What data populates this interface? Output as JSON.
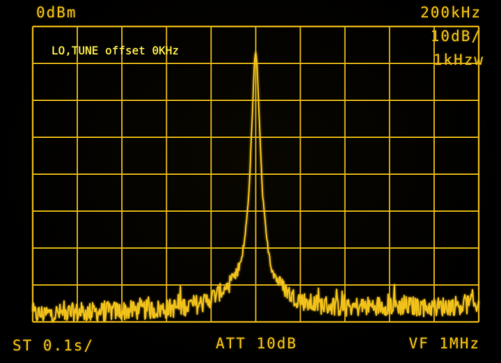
{
  "colors": {
    "phosphor": "#e8b914",
    "trace": "#f2c21b",
    "annotation": "#fff04a",
    "background": "#000000"
  },
  "readouts": {
    "ref_level": "0dBm",
    "span": "200kHz",
    "scale": "10dB/",
    "rbw": "1kHzw",
    "sweep_time": "ST 0.1s/",
    "attenuation": "ATT 10dB",
    "video_filter": "VF 1MHz"
  },
  "annotation": {
    "text": "LO,TUNE offset 0KHz"
  },
  "chart_data": {
    "type": "line",
    "grid": true,
    "grid_divisions": {
      "x": 10,
      "y": 8
    },
    "x_range_divisions": [
      -5,
      5
    ],
    "y_range_divisions": [
      -8,
      0
    ],
    "series": [
      {
        "x": [
          -5.0,
          -4.0,
          -3.0,
          -2.0,
          -1.2,
          -0.8,
          -0.5,
          -0.35,
          -0.25,
          -0.15,
          -0.08,
          -0.03,
          0.0,
          0.03,
          0.08,
          0.15,
          0.25,
          0.35,
          0.5,
          0.8,
          1.2,
          2.0,
          3.0,
          4.0,
          5.0
        ],
        "y": [
          -7.8,
          -7.75,
          -7.7,
          -7.65,
          -7.5,
          -7.2,
          -6.9,
          -6.5,
          -5.8,
          -4.5,
          -2.5,
          -1.0,
          -0.7,
          -1.0,
          -2.5,
          -4.5,
          -5.8,
          -6.5,
          -6.9,
          -7.3,
          -7.5,
          -7.6,
          -7.55,
          -7.6,
          -7.5
        ]
      }
    ]
  }
}
